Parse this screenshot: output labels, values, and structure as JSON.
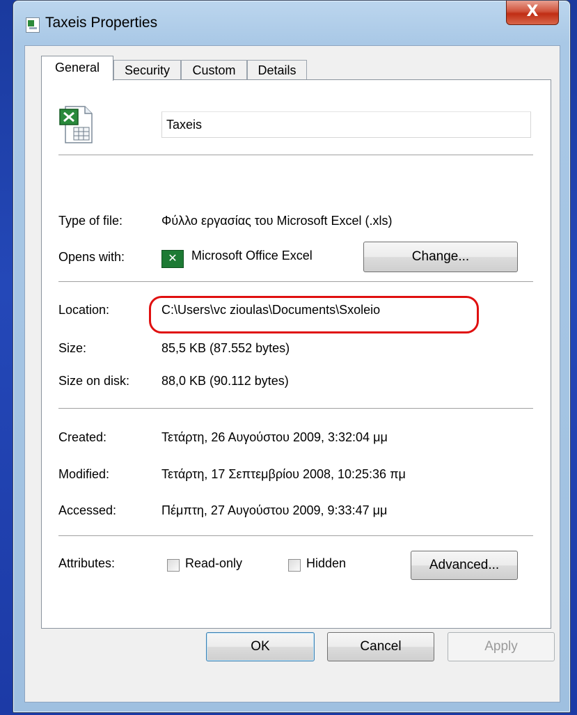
{
  "window": {
    "title": "Taxeis Properties",
    "close_glyph": "X"
  },
  "tabs": [
    {
      "label": "General"
    },
    {
      "label": "Security"
    },
    {
      "label": "Custom"
    },
    {
      "label": "Details"
    }
  ],
  "general": {
    "file_name": "Taxeis",
    "type_label": "Type of file:",
    "type_value": "Φύλλο εργασίας του Microsoft Excel (.xls)",
    "opens_label": "Opens with:",
    "opens_value": "Microsoft Office Excel",
    "change_button": "Change...",
    "location_label": "Location:",
    "location_value": "C:\\Users\\vc zioulas\\Documents\\Sxoleio",
    "size_label": "Size:",
    "size_value": "85,5 KB (87.552 bytes)",
    "size_disk_label": "Size on disk:",
    "size_disk_value": "88,0 KB (90.112 bytes)",
    "created_label": "Created:",
    "created_value": "Τετάρτη, 26 Αυγούστου 2009, 3:32:04 μμ",
    "modified_label": "Modified:",
    "modified_value": "Τετάρτη, 17 Σεπτεμβρίου 2008, 10:25:36 πμ",
    "accessed_label": "Accessed:",
    "accessed_value": "Πέμπτη, 27 Αυγούστου 2009, 9:33:47 μμ",
    "attributes_label": "Attributes:",
    "readonly_label": "Read-only",
    "hidden_label": "Hidden",
    "advanced_button": "Advanced..."
  },
  "footer": {
    "ok": "OK",
    "cancel": "Cancel",
    "apply": "Apply"
  },
  "icons": {
    "title": "excel-file-icon",
    "large": "excel-file-icon",
    "app": "excel-app-icon",
    "close": "close-icon"
  },
  "colors": {
    "highlight": "#e01010",
    "excel_green": "#1d7a34"
  }
}
